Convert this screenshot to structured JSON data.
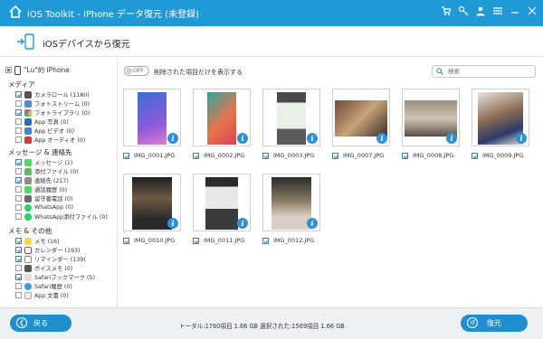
{
  "window": {
    "title": "iOS Toolkit - iPhone データ復元 (未登録)"
  },
  "header": {
    "title": "iOSデバイスから復元"
  },
  "colors": {
    "accent": "#1f9ad6",
    "button": "#1f8fd0"
  },
  "titlebar_icons": [
    "cart-icon",
    "key-icon",
    "user-icon",
    "menu-icon",
    "minimize-icon",
    "close-icon"
  ],
  "sidebar": {
    "device": "\"Lu\"的 iPhone",
    "categories": [
      {
        "label": "メディア",
        "items": [
          {
            "label": "カメラロール (1180)",
            "checked": true
          },
          {
            "label": "フォトストリーム (0)",
            "checked": false
          },
          {
            "label": "フォトライブラリ (0)",
            "checked": true
          },
          {
            "label": "App 写真 (0)",
            "checked": false
          },
          {
            "label": "App ビデオ (0)",
            "checked": false
          },
          {
            "label": "App オーディオ (0)",
            "checked": false
          }
        ]
      },
      {
        "label": "メッセージ & 連絡先",
        "items": [
          {
            "label": "メッセージ (1)",
            "checked": true
          },
          {
            "label": "添付ファイル (0)",
            "checked": false
          },
          {
            "label": "連絡先 (217)",
            "checked": true
          },
          {
            "label": "通話履歴 (0)",
            "checked": false
          },
          {
            "label": "留守番電話 (0)",
            "checked": false
          },
          {
            "label": "WhatsApp (0)",
            "checked": false
          },
          {
            "label": "WhatsApp添付ファイル (0)",
            "checked": false
          }
        ]
      },
      {
        "label": "メモ & その他",
        "items": [
          {
            "label": "メモ (16)",
            "checked": true
          },
          {
            "label": "カレンダー (193)",
            "checked": true
          },
          {
            "label": "リマインダー (139)",
            "checked": true
          },
          {
            "label": "ボイスメモ (0)",
            "checked": false
          },
          {
            "label": "Safariブックマーク (5)",
            "checked": true
          },
          {
            "label": "Safari履歴 (0)",
            "checked": false
          },
          {
            "label": "App 文書 (0)",
            "checked": false
          }
        ]
      }
    ]
  },
  "main": {
    "toggle_label": "OFF",
    "toggle_text": "削除された項目だけを表示する",
    "search_placeholder": "検索",
    "photos": [
      {
        "name": "IMG_0001.JPG"
      },
      {
        "name": "IMG_0002.JPG"
      },
      {
        "name": "IMG_0003.JPG"
      },
      {
        "name": "IMG_0007.JPG"
      },
      {
        "name": "IMG_0008.JPG"
      },
      {
        "name": "IMG_0009.JPG"
      },
      {
        "name": "IMG_0010.JPG"
      },
      {
        "name": "IMG_0011.JPG"
      },
      {
        "name": "IMG_0012.JPG"
      }
    ]
  },
  "footer": {
    "back_label": "戻る",
    "recover_label": "復元",
    "stats": "トータル:1760項目 1.66 GB   選択された:1569項目 1.66 GB"
  }
}
